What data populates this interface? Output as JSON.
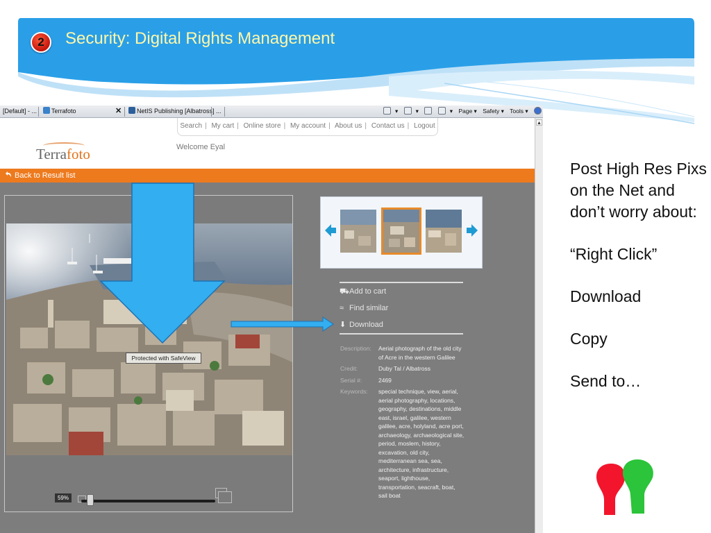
{
  "slide": {
    "badge": "2",
    "title": "Security: Digital Rights Management",
    "bullets_intro": "Post High Res Pixs on the Net and don’t worry about:",
    "bullets": [
      "“Right Click”",
      "Download",
      "Copy",
      "Send to…"
    ],
    "colors": {
      "title": "#fff7a8",
      "header_blue": "#2aa0e8",
      "badge_red": "#d61f12"
    }
  },
  "browser": {
    "tabs": [
      {
        "label": "[Default] - ..."
      },
      {
        "label": "Terrafoto"
      },
      {
        "label": "NetIS Publishing [Albatross] ..."
      }
    ],
    "toolbar": {
      "page": "Page ▾",
      "safety": "Safety ▾",
      "tools": "Tools ▾"
    }
  },
  "site": {
    "logo_main": "Terra",
    "logo_accent": "foto",
    "nav": [
      "Search",
      "My cart",
      "Online store",
      "My account",
      "About us",
      "Contact us",
      "Logout"
    ],
    "welcome": "Welcome Eyal",
    "back_link": "Back to Result list",
    "protect_label": "Protected with SafeView",
    "zoom_percent": "59%",
    "actions": {
      "add_to_cart": "Add to cart",
      "find_similar": "Find similar",
      "download": "Download"
    },
    "details": [
      {
        "key": "Description:",
        "value": "Aerial photograph of the old city of Acre in the western Galilee"
      },
      {
        "key": "Credit:",
        "value": "Duby Tal / Albatross"
      },
      {
        "key": "Serial #:",
        "value": "2469"
      },
      {
        "key": "Keywords:",
        "value": "special technique, view, aerial, aerial photography, locations, geography, destinations, middle east, israel, galilee, western galilee, acre, holyland, acre port, archaeology, archaeological site, period, moslem, history, excavation, old city, mediterranean sea, sea, architecture, infrastructure, seaport, lighthouse, transportation, seacraft, boat, sail boat"
      }
    ],
    "colors": {
      "orange": "#ee7a1e",
      "thumb_highlight": "#e88a2a",
      "arrow": "#2ea3e6"
    }
  },
  "icons": [
    "search-icon",
    "back-arrow-icon",
    "cart-icon",
    "similar-icon",
    "download-icon",
    "prev-arrow-icon",
    "next-arrow-icon",
    "zoom-small-icon",
    "zoom-large-icon",
    "home-icon",
    "help-icon"
  ]
}
